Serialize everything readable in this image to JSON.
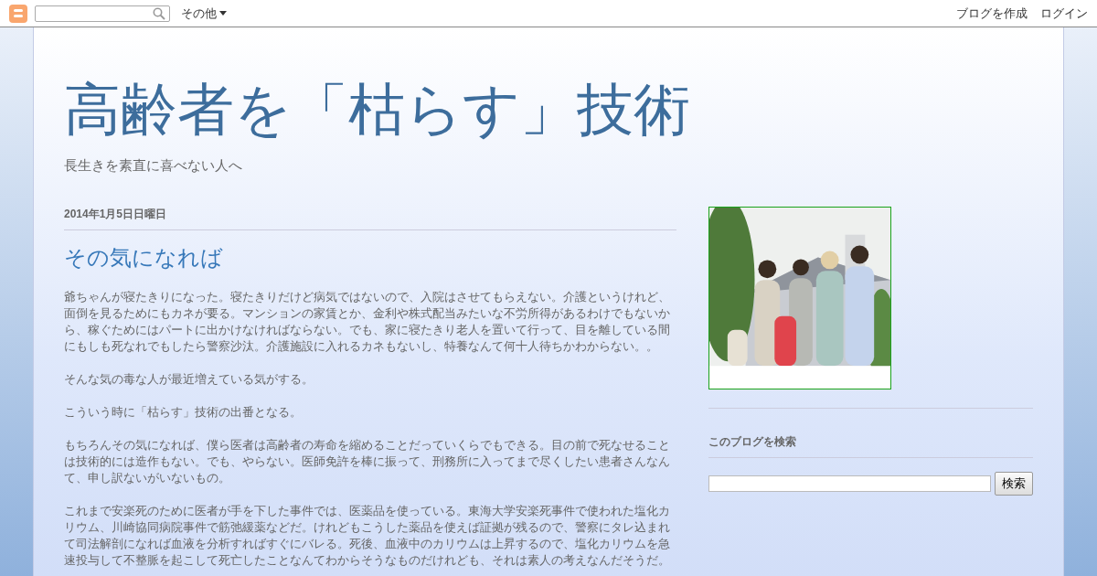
{
  "navbar": {
    "more_menu": "その他",
    "links": [
      "ブログを作成",
      "ログイン"
    ]
  },
  "header": {
    "title": "高齢者を「枯らす」技術",
    "description": "長生きを素直に喜べない人へ"
  },
  "post": {
    "date": "2014年1月5日日曜日",
    "title": "その気になれば",
    "paragraphs": [
      "爺ちゃんが寝たきりになった。寝たきりだけど病気ではないので、入院はさせてもらえない。介護というけれど、面倒を見るためにもカネが要る。マンションの家賃とか、金利や株式配当みたいな不労所得があるわけでもないから、稼ぐためにはパートに出かけなければならない。でも、家に寝たきり老人を置いて行って、目を離している間にもしも死なれでもしたら警察沙汰。介護施設に入れるカネもないし、特養なんて何十人待ちかわからない。。",
      "そんな気の毒な人が最近増えている気がする。",
      "こういう時に「枯らす」技術の出番となる。",
      "もちろんその気になれば、僕ら医者は高齢者の寿命を縮めることだっていくらでもできる。目の前で死なせることは技術的には造作もない。でも、やらない。医師免許を棒に振って、刑務所に入ってまで尽くしたい患者さんなんて、申し訳ないがいないもの。",
      "これまで安楽死のために医者が手を下した事件では、医薬品を使っている。東海大学安楽死事件で使われた塩化カリウム、川崎協同病院事件で筋弛緩薬などだ。けれどもこうした薬品を使えば証拠が残るので、警察にタレ込まれて司法解剖になれば血液を分析すればすぐにバレる。死後、血液中のカリウムは上昇するので、塩化カリウムを急速投与して不整脈を起こして死亡したことなんてわからそうなものだけれども、それは素人の考えなんだそうだ。"
    ]
  },
  "sidebar": {
    "search_widget": {
      "title": "このブログを検索",
      "button": "検索"
    }
  }
}
